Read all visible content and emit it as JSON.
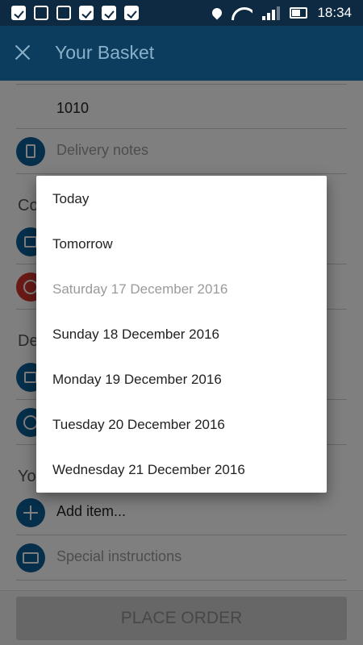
{
  "status_bar": {
    "time": "18:34"
  },
  "app_bar": {
    "title": "Your Basket"
  },
  "form": {
    "postcode_value": "1010",
    "delivery_notes_placeholder": "Delivery notes",
    "section_collection_partial": "Co",
    "section_delivery_partial": "De",
    "section_your_partial": "Yo",
    "add_item_label": "Add item...",
    "special_instructions_placeholder": "Special instructions"
  },
  "order_button": {
    "label": "PLACE ORDER"
  },
  "date_picker": {
    "options": [
      {
        "label": "Today",
        "enabled": true
      },
      {
        "label": "Tomorrow",
        "enabled": true
      },
      {
        "label": "Saturday 17 December 2016",
        "enabled": false
      },
      {
        "label": "Sunday 18 December 2016",
        "enabled": true
      },
      {
        "label": "Monday 19 December 2016",
        "enabled": true
      },
      {
        "label": "Tuesday 20 December 2016",
        "enabled": true
      },
      {
        "label": "Wednesday 21 December 2016",
        "enabled": true
      }
    ]
  },
  "colors": {
    "app_bar": "#0c3d5e",
    "status_bar": "#0d2a42",
    "icon_blue": "#0a5f97",
    "icon_red": "#d2342c"
  }
}
